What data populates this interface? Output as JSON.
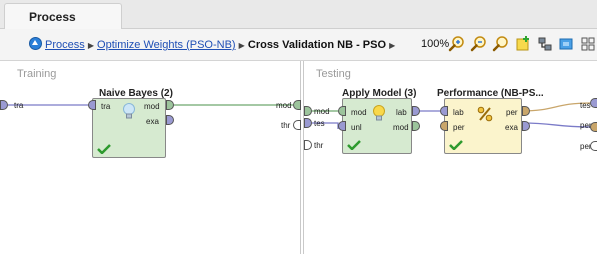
{
  "tab": {
    "label": "Process"
  },
  "breadcrumb": {
    "items": [
      {
        "label": "Process"
      },
      {
        "label": "Optimize Weights (PSO-NB)"
      },
      {
        "label": "Cross Validation NB - PSO"
      }
    ],
    "separator": "▶"
  },
  "toolbar": {
    "zoom": "100%",
    "tools": [
      "zoom-in-icon",
      "zoom-out-icon",
      "zoom-fit-icon",
      "add-note-icon",
      "auto-wire-icon",
      "arrange-icon",
      "grid-icon"
    ]
  },
  "training": {
    "label": "Training",
    "in_port": "tra",
    "out_port": "mod",
    "thr_port": "thr",
    "operator": {
      "title": "Naive Bayes (2)",
      "in": "tra",
      "out1": "mod",
      "out2": "exa"
    }
  },
  "testing": {
    "label": "Testing",
    "in1": "mod",
    "in2": "tes",
    "in3": "thr",
    "out1": "tes",
    "out2": "per",
    "out3": "per",
    "apply": {
      "title": "Apply Model (3)",
      "in1": "mod",
      "in2": "unl",
      "out1": "lab",
      "out2": "mod"
    },
    "perf": {
      "title": "Performance (NB-PS...",
      "in1": "lab",
      "in2": "per",
      "out1": "per",
      "out2": "exa"
    }
  },
  "colors": {
    "operator_green": "#d6ead0",
    "operator_yellow": "#fbf4cc",
    "link": "#1f4fb5",
    "wire_purple": "#7b7bc8",
    "wire_green": "#6da86d",
    "wire_tan": "#c9a66b"
  }
}
